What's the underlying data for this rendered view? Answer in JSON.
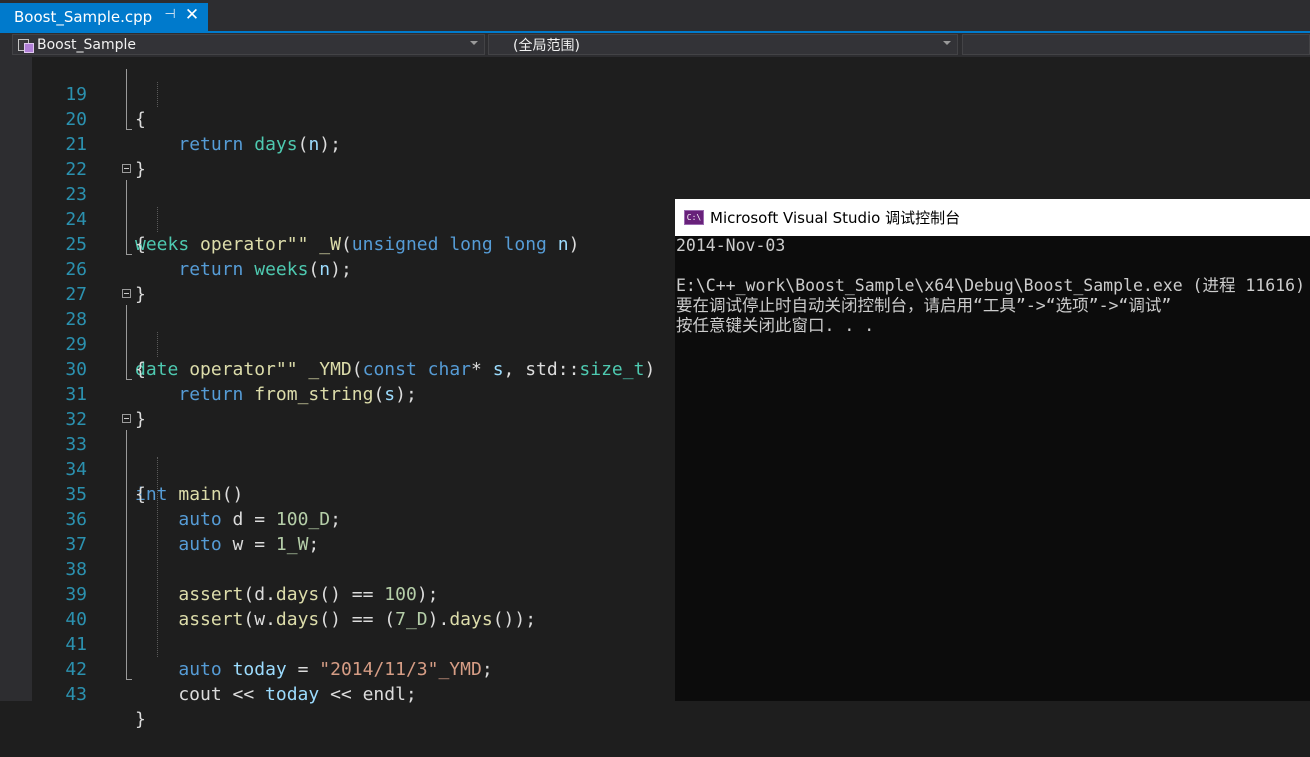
{
  "tab": {
    "title": "Boost_Sample.cpp",
    "pin_glyph": "⊣",
    "close_glyph": "✕"
  },
  "navbar": {
    "project": "Boost_Sample",
    "scope": "(全局范围)"
  },
  "editor": {
    "lines": [
      {
        "n": "19"
      },
      {
        "n": "20"
      },
      {
        "n": "21"
      },
      {
        "n": "22"
      },
      {
        "n": "23"
      },
      {
        "n": "24"
      },
      {
        "n": "25"
      },
      {
        "n": "26"
      },
      {
        "n": "27"
      },
      {
        "n": "28"
      },
      {
        "n": "29"
      },
      {
        "n": "30"
      },
      {
        "n": "31"
      },
      {
        "n": "32"
      },
      {
        "n": "33"
      },
      {
        "n": "34"
      },
      {
        "n": "35"
      },
      {
        "n": "36"
      },
      {
        "n": "37"
      },
      {
        "n": "38"
      },
      {
        "n": "39"
      },
      {
        "n": "40"
      },
      {
        "n": "41"
      },
      {
        "n": "42"
      },
      {
        "n": "43"
      }
    ],
    "code": {
      "l19": {
        "t1": "{"
      },
      "l20": {
        "t1": "    ",
        "t2": "return",
        "t3": " ",
        "t4": "days",
        "t5": "(",
        "t6": "n",
        "t7": ");"
      },
      "l21": {
        "t1": "}"
      },
      "l23": {
        "t1": "weeks",
        "t2": " ",
        "t3": "operator\"\"",
        "t4": " ",
        "t5": "_W",
        "t6": "(",
        "t7": "unsigned",
        "t8": " ",
        "t9": "long",
        "t10": " ",
        "t11": "long",
        "t12": " ",
        "t13": "n",
        "t14": ")"
      },
      "l24": {
        "t1": "{"
      },
      "l25": {
        "t1": "    ",
        "t2": "return",
        "t3": " ",
        "t4": "weeks",
        "t5": "(",
        "t6": "n",
        "t7": ");"
      },
      "l26": {
        "t1": "}"
      },
      "l28": {
        "t1": "date",
        "t2": " ",
        "t3": "operator\"\"",
        "t4": " ",
        "t5": "_YMD",
        "t6": "(",
        "t7": "const",
        "t8": " ",
        "t9": "char",
        "t10": "* ",
        "t11": "s",
        "t12": ", std::",
        "t13": "size_t",
        "t14": ")"
      },
      "l29": {
        "t1": "{"
      },
      "l30": {
        "t1": "    ",
        "t2": "return",
        "t3": " ",
        "t4": "from_string",
        "t5": "(",
        "t6": "s",
        "t7": ");"
      },
      "l31": {
        "t1": "}"
      },
      "l33": {
        "t1": "int",
        "t2": " ",
        "t3": "main",
        "t4": "()"
      },
      "l34": {
        "t1": "{"
      },
      "l35": {
        "t1": "    ",
        "t2": "auto",
        "t3": " d = ",
        "t4": "100_D",
        "t5": ";"
      },
      "l36": {
        "t1": "    ",
        "t2": "auto",
        "t3": " w = ",
        "t4": "1_W",
        "t5": ";"
      },
      "l38": {
        "t1": "    ",
        "t2": "assert",
        "t3": "(d.",
        "t4": "days",
        "t5": "() == ",
        "t6": "100",
        "t7": ");"
      },
      "l39": {
        "t1": "    ",
        "t2": "assert",
        "t3": "(w.",
        "t4": "days",
        "t5": "() == (",
        "t6": "7_D",
        "t7": ").",
        "t8": "days",
        "t9": "());"
      },
      "l41": {
        "t1": "    ",
        "t2": "auto",
        "t3": " ",
        "t4": "today",
        "t5": " = ",
        "t6": "\"2014/11/3\"_YMD",
        "t7": ";"
      },
      "l42": {
        "t1": "    cout << ",
        "t2": "today",
        "t3": " << endl;"
      },
      "l43": {
        "t1": "}"
      }
    }
  },
  "console": {
    "title": "Microsoft Visual Studio 调试控制台",
    "icon_text": "C:\\",
    "lines": [
      "2014-Nov-03",
      "",
      "E:\\C++_work\\Boost_Sample\\x64\\Debug\\Boost_Sample.exe (进程 11616)",
      "要在调试停止时自动关闭控制台，请启用“工具”->“选项”->“调试”",
      "按任意键关闭此窗口. . ."
    ]
  },
  "colors": {
    "accent": "#007acc",
    "editor_bg": "#1e1e1e",
    "keyword": "#569cd6",
    "type": "#4ec9b0",
    "function": "#dcdcaa",
    "string": "#d69d85",
    "number": "#b5cea8",
    "parameter": "#9cdcfe",
    "line_number": "#2b91af"
  }
}
